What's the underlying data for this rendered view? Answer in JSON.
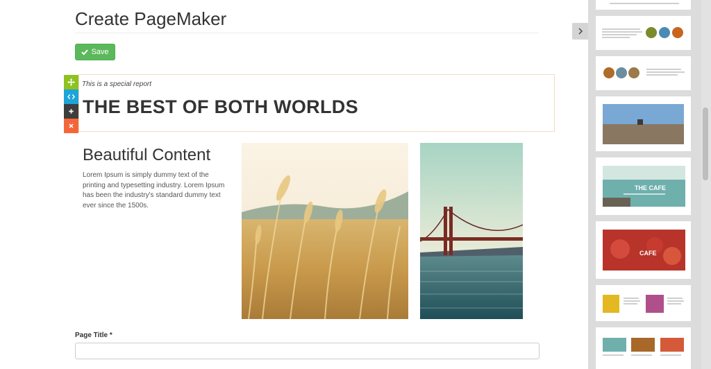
{
  "header": {
    "title": "Create PageMaker"
  },
  "toolbar": {
    "save_label": "Save"
  },
  "editor": {
    "tools": [
      "move-icon",
      "code-icon",
      "plus-icon",
      "close-icon"
    ],
    "special_block": {
      "subtitle": "This is a special report",
      "heading": "THE BEST OF BOTH WORLDS"
    },
    "content_block": {
      "heading": "Beautiful Content",
      "body": "Lorem Ipsum is simply dummy text of the printing and typesetting industry. Lorem Ipsum has been the industry's standard dummy text ever since the 1500s."
    }
  },
  "form": {
    "page_title_label": "Page Title *",
    "page_title_value": "",
    "page_title_placeholder": ""
  },
  "sidebar": {
    "templates": [
      {
        "id": "top-partial"
      },
      {
        "id": "text-three-circles"
      },
      {
        "id": "three-circles-text"
      },
      {
        "id": "beach-banner"
      },
      {
        "id": "cafe-sea-banner",
        "label": "THE CAFE"
      },
      {
        "id": "cafe-strawberry-banner",
        "label": "CAFE"
      },
      {
        "id": "two-images-text"
      },
      {
        "id": "three-images-captions"
      }
    ]
  },
  "colors": {
    "save": "#5cb85c",
    "move_tool": "#8dc21f",
    "code_tool": "#1da4d8",
    "add_tool": "#3d3d3d",
    "delete_tool": "#f4663a",
    "block_border": "#f1dcbc"
  }
}
